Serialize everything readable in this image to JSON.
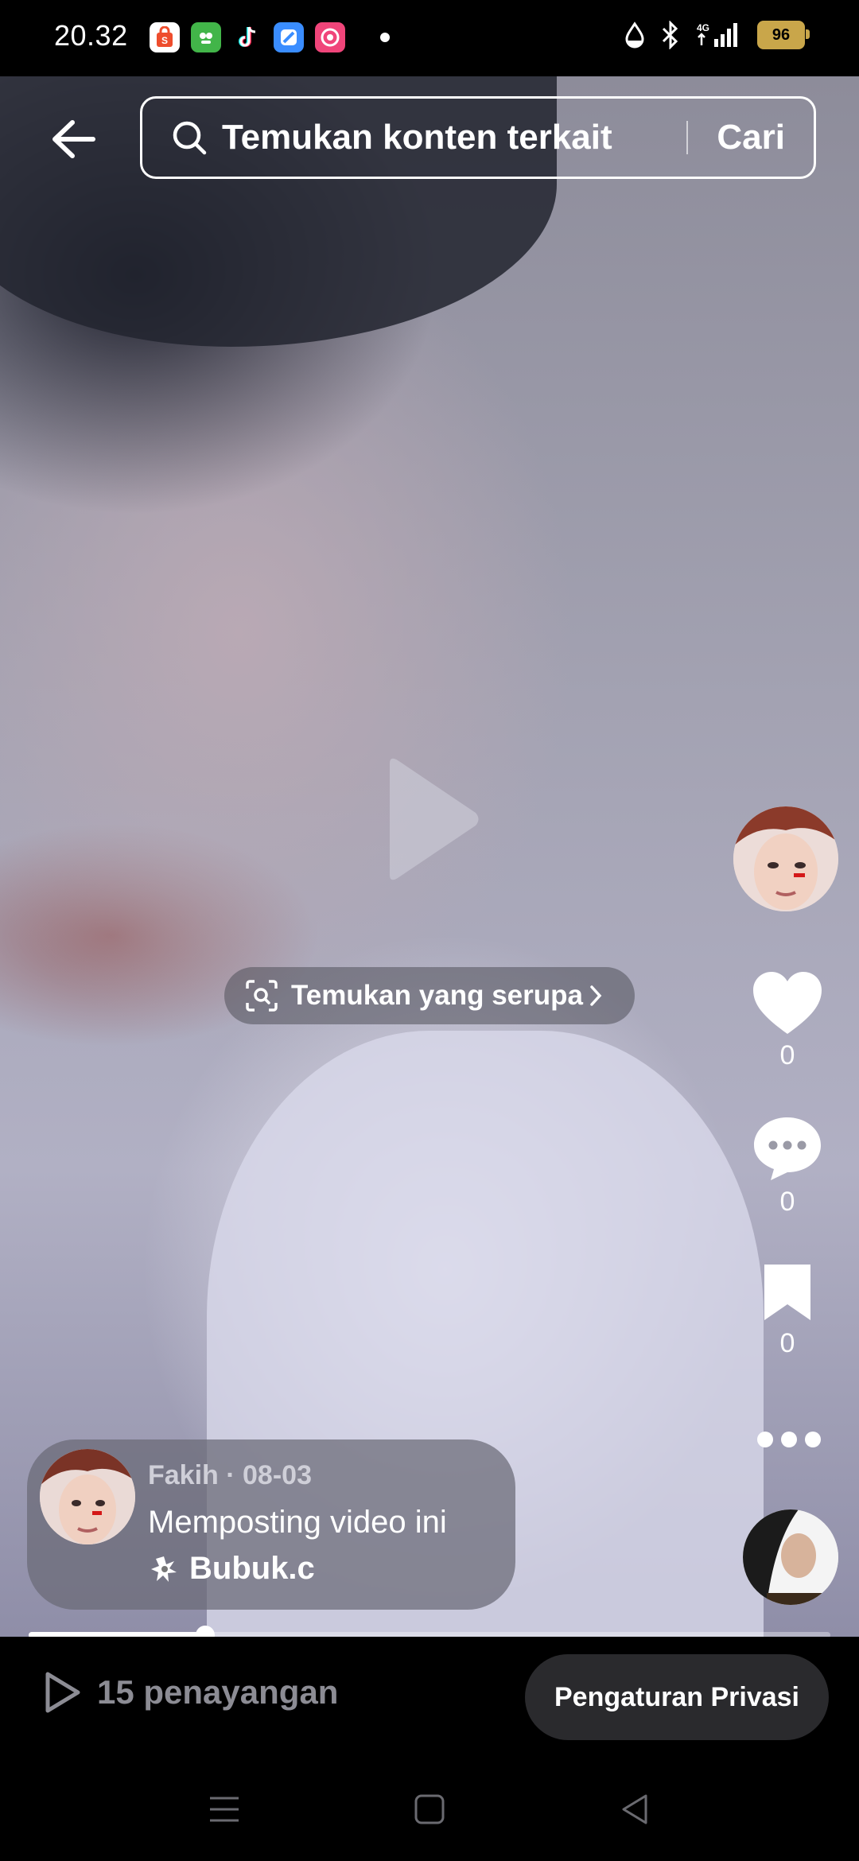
{
  "status_bar": {
    "time": "20.32",
    "battery": "96",
    "network": "4G"
  },
  "notification_icons": [
    {
      "name": "shopee-icon",
      "color": "#ffffff"
    },
    {
      "name": "tokopedia-icon",
      "color": "#42b549"
    },
    {
      "name": "tiktok-icon",
      "color": "#000000"
    },
    {
      "name": "app-blue-icon",
      "color": "#3a8dff"
    },
    {
      "name": "lazada-icon",
      "color": "#f0457a"
    }
  ],
  "search": {
    "placeholder": "Temukan konten terkait",
    "submit_label": "Cari"
  },
  "find_similar": {
    "label": "Temukan yang serupa"
  },
  "actions": {
    "likes": "0",
    "comments": "0",
    "saves": "0"
  },
  "caption": {
    "meta": "Fakih · 08-03",
    "text": "Memposting video ini",
    "effect": "Bubuk.c"
  },
  "playback": {
    "progress": 0.22
  },
  "footer": {
    "views": "15 penayangan",
    "privacy_button": "Pengaturan Privasi"
  }
}
